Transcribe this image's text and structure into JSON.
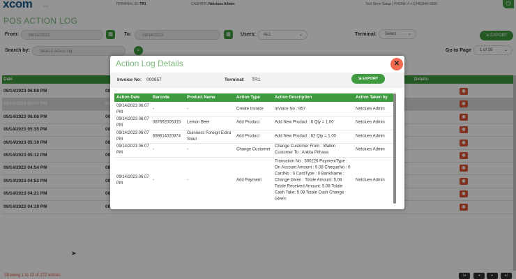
{
  "header": {
    "logo": "xcom",
    "logo_sub": "pos",
    "terminal_label": "TERMINAL ID:",
    "terminal_value": "TR1",
    "cashier_label": "CASHIER:",
    "cashier_value": "Netclues Admin",
    "store_info": "Test Store Setup | PHONE # +1(345)948-0000"
  },
  "page_title": "POS ACTION LOG",
  "filters": {
    "from_label": "From:",
    "from_value": "06/15/2023",
    "to_label": "To:",
    "to_value": "09/14/2023",
    "users_label": "Users:",
    "users_value": "ALL",
    "terminal_label": "Terminal:",
    "terminal_value": "Select",
    "export_label": "EXPORT",
    "search_label": "Search by:",
    "search_placeholder": "Search action log",
    "goto_label": "Go to Page",
    "goto_value": "1 of 28"
  },
  "table": {
    "columns": [
      "Date",
      "",
      "Details"
    ],
    "rows": [
      {
        "date": "09/14/2023 06:08 PM",
        "c2": "00"
      },
      {
        "date": "09/14/2023 06:07 PM",
        "c2": "00"
      },
      {
        "date": "09/14/2023 06:06 PM",
        "c2": "00"
      },
      {
        "date": "09/14/2023 05:35 PM",
        "c2": "00"
      },
      {
        "date": "09/14/2023 05:19 PM",
        "c2": "00"
      },
      {
        "date": "09/14/2023 05:12 PM",
        "c2": "00"
      },
      {
        "date": "09/14/2023 04:54 PM",
        "c2": "00"
      },
      {
        "date": "09/14/2023 04:52 PM",
        "c2": "00"
      },
      {
        "date": "09/14/2023 04:21 PM",
        "c2": "00"
      },
      {
        "date": "09/14/2023 04:19 PM",
        "c2": "00"
      }
    ],
    "footer": "Showing 1 to 10 of 272 entries",
    "pagination": [
      "|◂",
      "◂",
      "▸",
      "▸|"
    ]
  },
  "modal": {
    "title": "Action Log Details",
    "invoice_label": "Invoice No:",
    "invoice_value": "000957",
    "terminal_label": "Terminal:",
    "terminal_value": "TR1",
    "export_label": "EXPORT",
    "columns": [
      "Action Date",
      "Barcode",
      "Product Name",
      "Action Type",
      "Action Description",
      "Action Taken by"
    ],
    "rows": [
      {
        "date": "09/14/2023 06:07 PM",
        "barcode": "-",
        "product": "-",
        "type": "Create Invoice",
        "desc": "InVoice No : 957",
        "by": "Netclues Admin"
      },
      {
        "date": "09/14/2023 06:07 PM",
        "barcode": "087692005315",
        "product": "Lemon Beer",
        "type": "Add Product",
        "desc": "Add New Product : 6  Qty = 1.00",
        "by": "Netclues Admin"
      },
      {
        "date": "09/14/2023 06:07 PM",
        "barcode": "698614020974",
        "product": "Guinness Foreign Extra Stout",
        "type": "Add Product",
        "desc": "Add New Product : 62  Qty = 1.00",
        "by": "Netclues Admin"
      },
      {
        "date": "09/14/2023 06:07 PM",
        "barcode": "-",
        "product": "-",
        "type": "Change Customer",
        "desc": "Change Customer From : Walkin Customer To :  Ankita Pithava",
        "by": "Netclues Admin"
      },
      {
        "date": "09/14/2023 06:07 PM",
        "barcode": "-",
        "product": "-",
        "type": "Add Payment",
        "desc": "Transation No : 500226 PaymentType : On Account Amount : 5.08  ChequeNo  : 0 CardNo : 0  CardType : 0 BankName : Change Given :  Totale Amount: 5.08 Totale Received Amount: 5.08 Totale Cash Take: 5.08 Totale Cash Change Given:",
        "by": "Netclues Admin"
      }
    ]
  },
  "colors": {
    "accent": "#3f9a3f",
    "danger": "#e05535",
    "title_green": "#7ab87a"
  },
  "icons": {
    "calendar": "calendar-icon",
    "search": "search-icon",
    "export": "export-icon",
    "close": "close-icon",
    "view": "eye-icon"
  }
}
